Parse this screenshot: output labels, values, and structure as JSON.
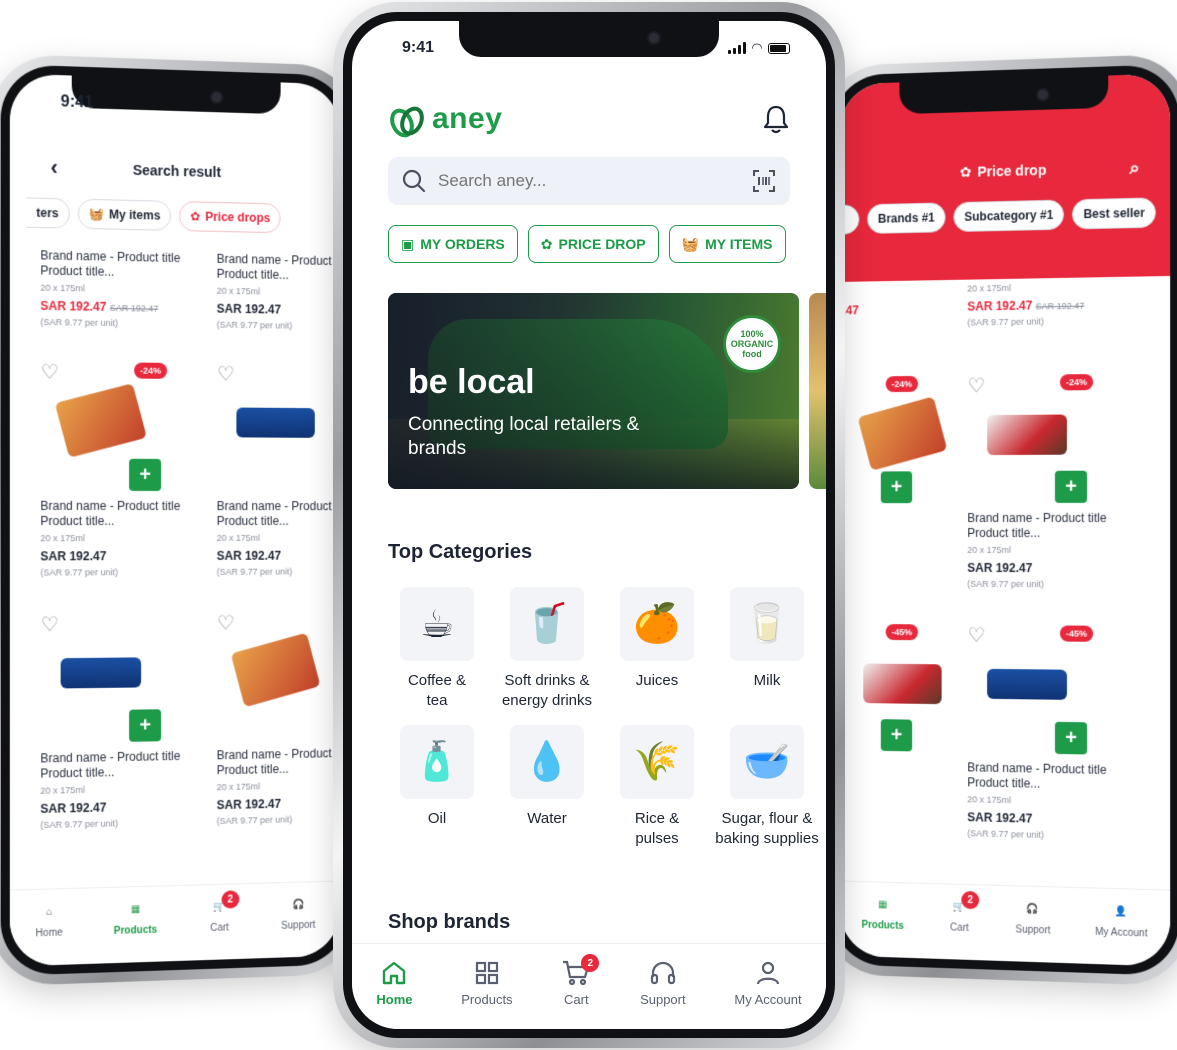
{
  "status": {
    "time": "9:41"
  },
  "center": {
    "brand": "aney",
    "search": {
      "placeholder": "Search aney..."
    },
    "pills": [
      {
        "label": "MY ORDERS",
        "icon": "box-icon"
      },
      {
        "label": "PRICE DROP",
        "icon": "discount-icon"
      },
      {
        "label": "MY ITEMS",
        "icon": "basket-icon"
      }
    ],
    "banner": {
      "title": "be local",
      "subtitle": "Connecting local retailers & brands",
      "badge": "100% ORGANIC food"
    },
    "top_categories_title": "Top Categories",
    "categories": [
      {
        "label": "Coffee & tea",
        "icon": "coffee-icon",
        "glyph": "☕"
      },
      {
        "label": "Soft drinks & energy drinks",
        "icon": "soda-icon",
        "glyph": "🥤"
      },
      {
        "label": "Juices",
        "icon": "juice-icon",
        "glyph": "🍊"
      },
      {
        "label": "Milk",
        "icon": "milk-icon",
        "glyph": "🥛"
      },
      {
        "label": "Oil",
        "icon": "oil-icon",
        "glyph": "🧴"
      },
      {
        "label": "Water",
        "icon": "water-icon",
        "glyph": "💧"
      },
      {
        "label": "Rice & pulses",
        "icon": "rice-icon",
        "glyph": "🌾"
      },
      {
        "label": "Sugar, flour & baking supplies",
        "icon": "flour-icon",
        "glyph": "🥣"
      }
    ],
    "shop_brands_title": "Shop brands",
    "tabs": [
      {
        "label": "Home",
        "icon": "home-icon"
      },
      {
        "label": "Products",
        "icon": "grid-icon"
      },
      {
        "label": "Cart",
        "icon": "cart-icon",
        "badge": "2"
      },
      {
        "label": "Support",
        "icon": "headset-icon"
      },
      {
        "label": "My Account",
        "icon": "user-icon"
      }
    ]
  },
  "left": {
    "title": "Search result",
    "pills": [
      "ters",
      "My items",
      "Price drops"
    ],
    "product": {
      "title": "Brand name - Product title Product title...",
      "size": "20 x 175ml",
      "price": "SAR 192.47",
      "old_price": "SAR 192.47",
      "unit": "(SAR 9.77 per unit)",
      "discount": "-24%"
    },
    "tabs": [
      "Home",
      "Products",
      "Cart",
      "Support"
    ]
  },
  "right": {
    "title": "Price drop",
    "pills": [
      "Brands #1",
      "Subcategory #1",
      "Best seller"
    ],
    "discounts": [
      "-24%",
      "-45%"
    ],
    "tabs": [
      "Products",
      "Cart",
      "Support",
      "My Account"
    ]
  },
  "colors": {
    "green": "#1d9b48",
    "red": "#e8283c",
    "text": "#1d2433"
  }
}
